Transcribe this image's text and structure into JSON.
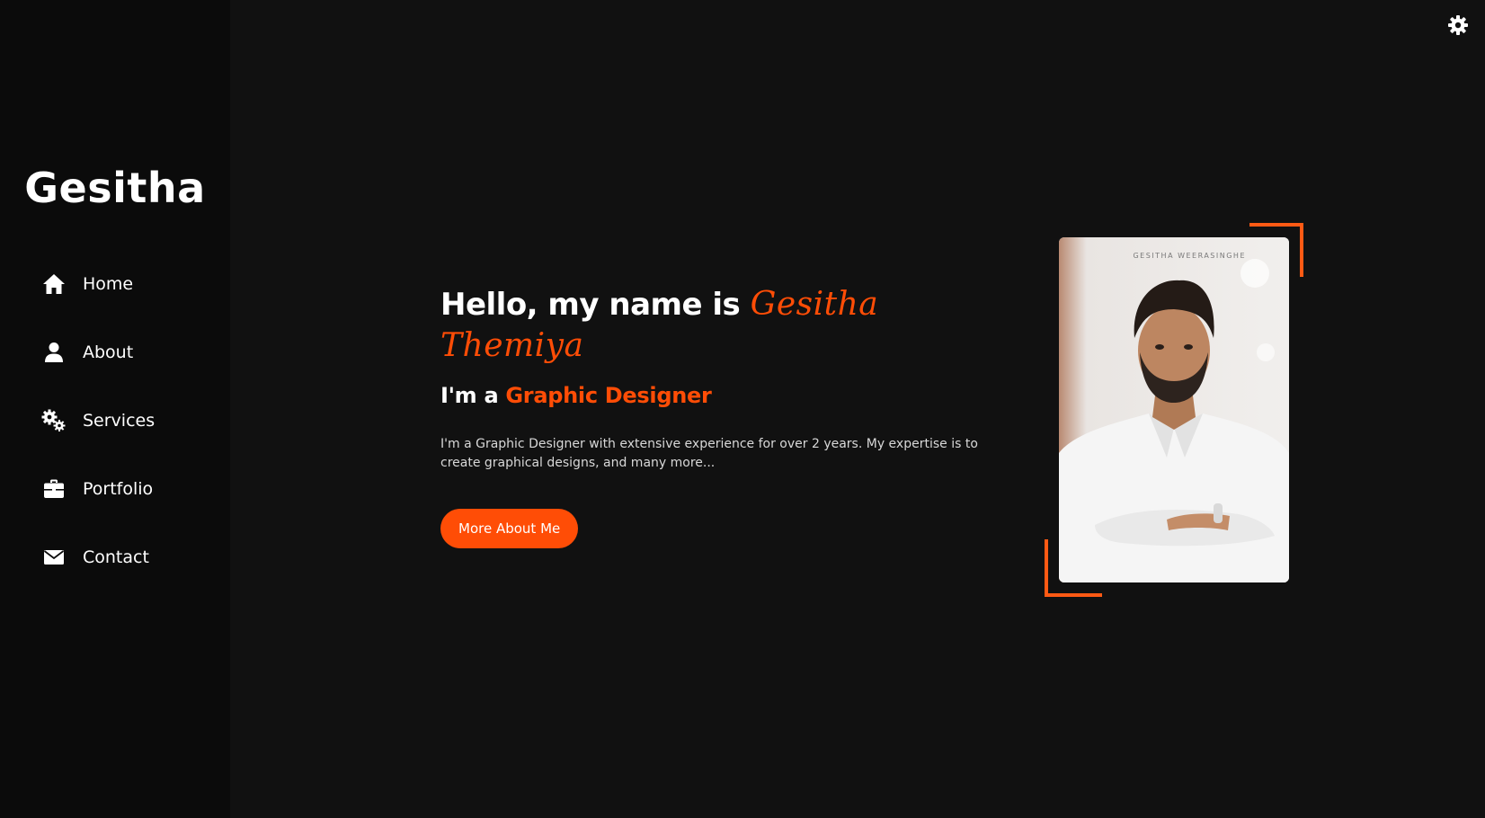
{
  "sidebar": {
    "logo": "Gesitha",
    "items": [
      {
        "label": "Home",
        "icon": "home-icon"
      },
      {
        "label": "About",
        "icon": "user-icon"
      },
      {
        "label": "Services",
        "icon": "gears-icon"
      },
      {
        "label": "Portfolio",
        "icon": "briefcase-icon"
      },
      {
        "label": "Contact",
        "icon": "envelope-icon"
      }
    ]
  },
  "header": {
    "theme_toggle_icon": "gear-icon"
  },
  "hero": {
    "title_prefix": "Hello, my name is ",
    "name": "Gesitha Themiya",
    "role_prefix": "I'm a ",
    "role": "Graphic Designer",
    "description": "I'm a Graphic Designer with extensive experience for over 2 years. My expertise is to create graphical designs, and many more...",
    "button_label": "More About Me"
  },
  "portrait": {
    "watermark": "GESITHA WEERASINGHE"
  },
  "colors": {
    "accent": "#ff4d06",
    "background": "#111111",
    "sidebar": "#0b0b0b",
    "text": "#ffffff"
  }
}
